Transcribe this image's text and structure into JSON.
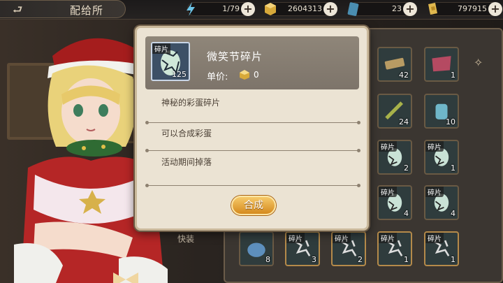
{
  "header": {
    "title": "配给所"
  },
  "resources": [
    {
      "name": "lightning-icon",
      "value": "1/79"
    },
    {
      "name": "gold-cube-icon",
      "value": "2604313"
    },
    {
      "name": "blue-card-icon",
      "value": "23"
    },
    {
      "name": "gold-coin-icon",
      "value": "797915"
    }
  ],
  "modal": {
    "item_name": "微笑节碎片",
    "item_tag": "碎片",
    "item_count": "125",
    "price_label": "单价:",
    "price_value": "0",
    "descriptions": [
      "神秘的彩蛋碎片",
      "可以合成彩蛋",
      "活动期间掉落"
    ],
    "synthesize_label": "合成"
  },
  "grid": {
    "equip_label": "快装",
    "slots": [
      {
        "tag": "",
        "count": "42",
        "art": "scroll"
      },
      {
        "tag": "",
        "count": "1",
        "art": "ribbon"
      },
      {
        "tag": "",
        "count": "24",
        "art": "stick"
      },
      {
        "tag": "",
        "count": "10",
        "art": "jar"
      },
      {
        "tag": "碎片",
        "count": "2",
        "art": "egg"
      },
      {
        "tag": "碎片",
        "count": "1",
        "art": "egg"
      },
      {
        "tag": "碎片",
        "count": "4",
        "art": "egg"
      },
      {
        "tag": "碎片",
        "count": "4",
        "art": "egg"
      },
      {
        "tag": "",
        "count": "8",
        "art": "blue"
      },
      {
        "tag": "碎片",
        "count": "3",
        "art": "frag"
      },
      {
        "tag": "碎片",
        "count": "2",
        "art": "frag"
      },
      {
        "tag": "碎片",
        "count": "1",
        "art": "frag"
      },
      {
        "tag": "碎片",
        "count": "1",
        "art": "frag"
      }
    ]
  }
}
